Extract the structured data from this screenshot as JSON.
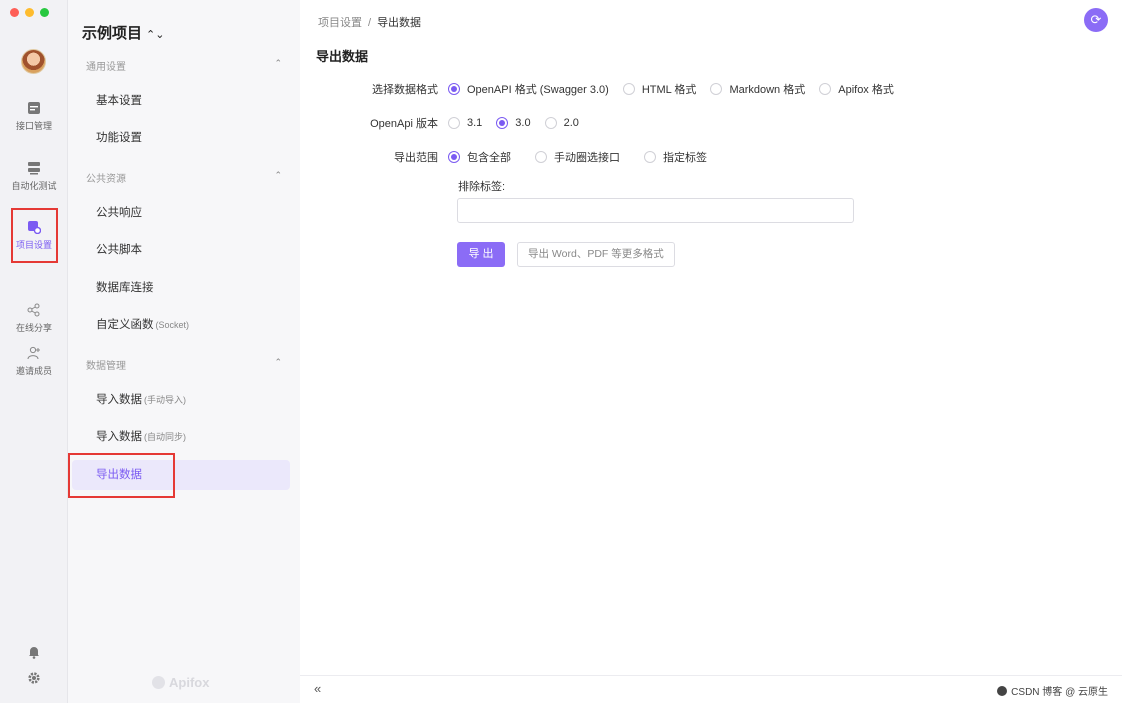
{
  "rail": {
    "items": [
      {
        "label": "接口管理",
        "icon": "api-icon"
      },
      {
        "label": "自动化测试",
        "icon": "test-icon"
      },
      {
        "label": "项目设置",
        "icon": "settings-project-icon"
      },
      {
        "label": "在线分享",
        "icon": "share-icon"
      },
      {
        "label": "邀请成员",
        "icon": "invite-icon"
      }
    ],
    "active": "项目设置"
  },
  "sidebar": {
    "project_title": "示例项目",
    "groups": [
      {
        "title": "通用设置",
        "items": [
          "基本设置",
          "功能设置"
        ]
      },
      {
        "title": "公共资源",
        "items": [
          "公共响应",
          "公共脚本",
          "数据库连接",
          "自定义函数"
        ]
      },
      {
        "title": "数据管理",
        "items": [
          "导入数据",
          "导入数据",
          "导出数据"
        ]
      }
    ],
    "item_suffix": {
      "custom_fn": "(Socket)",
      "import_manual": "(手动导入)",
      "import_auto": "(自动同步)"
    },
    "brand": "Apifox"
  },
  "main": {
    "breadcrumb": {
      "parent": "项目设置",
      "sep": "/",
      "current": "导出数据"
    },
    "title": "导出数据",
    "format": {
      "label": "选择数据格式",
      "options": [
        "OpenAPI 格式 (Swagger 3.0)",
        "HTML 格式",
        "Markdown 格式",
        "Apifox 格式"
      ],
      "selected": "OpenAPI 格式 (Swagger 3.0)"
    },
    "version": {
      "label": "OpenApi 版本",
      "options": [
        "3.1",
        "3.0",
        "2.0"
      ],
      "selected": "3.0"
    },
    "scope": {
      "label": "导出范围",
      "options": [
        "包含全部",
        "手动圈选接口",
        "指定标签"
      ],
      "selected": "包含全部"
    },
    "exclude_label": "排除标签:",
    "exclude_value": "",
    "export_button": "导 出",
    "more_button": "导出 Word、PDF 等更多格式"
  },
  "footer": {
    "collapse": "«",
    "right_text": "CSDN 博客 @ 云原生"
  },
  "colors": {
    "accent": "#8b6cf6",
    "highlight": "#e53935"
  }
}
